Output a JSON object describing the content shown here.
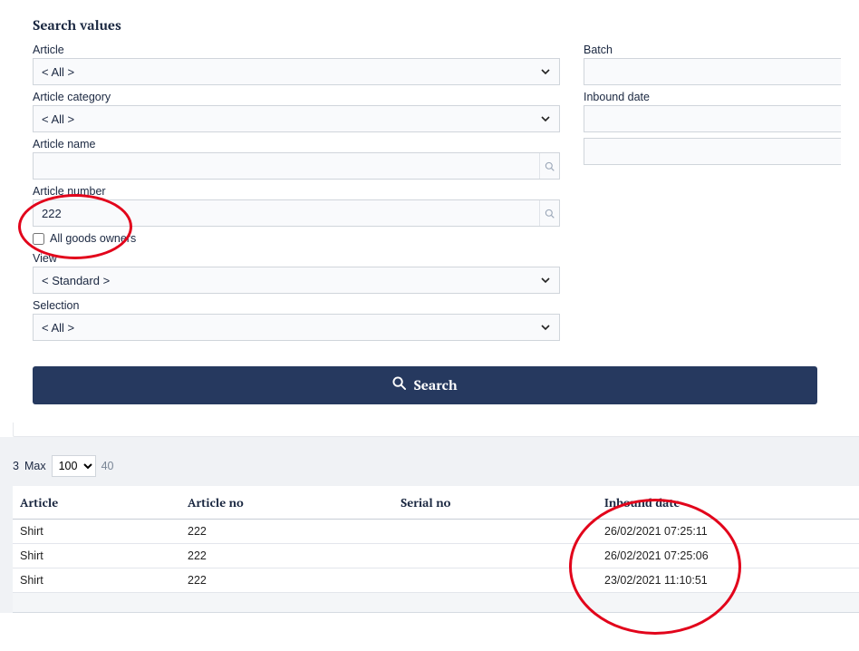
{
  "heading": "Search values",
  "left": {
    "article": {
      "label": "Article",
      "value": "< All >"
    },
    "article_category": {
      "label": "Article category",
      "value": "< All >"
    },
    "article_name": {
      "label": "Article name",
      "value": ""
    },
    "article_number": {
      "label": "Article number",
      "value": "222"
    },
    "all_goods_owners": {
      "label": "All goods owners",
      "checked": false
    },
    "view": {
      "label": "View",
      "value": "< Standard >"
    },
    "selection": {
      "label": "Selection",
      "value": "< All >"
    }
  },
  "right": {
    "batch": {
      "label": "Batch",
      "value": ""
    },
    "inbound_date": {
      "label": "Inbound date",
      "value": ""
    },
    "unnamed": {
      "label": "",
      "value": ""
    }
  },
  "search_button": "Search",
  "pager": {
    "count": "3",
    "max_label": "Max",
    "page_size": "100",
    "page_size_options": [
      "100"
    ],
    "total": "40"
  },
  "table": {
    "columns": [
      "Article",
      "Article no",
      "Serial no",
      "Inbound date"
    ],
    "rows": [
      {
        "article": "Shirt",
        "article_no": "222",
        "serial_no": "",
        "inbound_date": "26/02/2021 07:25:11"
      },
      {
        "article": "Shirt",
        "article_no": "222",
        "serial_no": "",
        "inbound_date": "26/02/2021 07:25:06"
      },
      {
        "article": "Shirt",
        "article_no": "222",
        "serial_no": "",
        "inbound_date": "23/02/2021 11:10:51"
      }
    ]
  }
}
